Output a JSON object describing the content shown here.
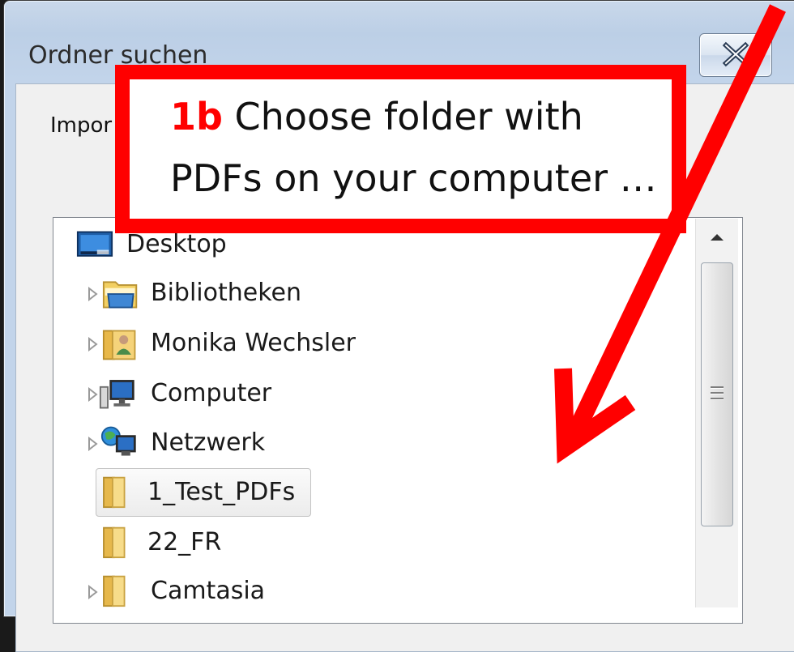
{
  "window": {
    "title": "Ordner suchen"
  },
  "prompt": "Impor",
  "tree": {
    "root": {
      "label": "Desktop",
      "icon": "desktop-icon"
    },
    "items": [
      {
        "label": "Bibliotheken",
        "icon": "libraries-icon",
        "expandable": true
      },
      {
        "label": "Monika Wechsler",
        "icon": "user-folder-icon",
        "expandable": true
      },
      {
        "label": "Computer",
        "icon": "computer-icon",
        "expandable": true
      },
      {
        "label": "Netzwerk",
        "icon": "network-icon",
        "expandable": true
      },
      {
        "label": "1_Test_PDFs",
        "icon": "folder-icon",
        "expandable": false,
        "selected": true
      },
      {
        "label": "22_FR",
        "icon": "folder-icon",
        "expandable": false
      },
      {
        "label": "Camtasia",
        "icon": "folder-icon",
        "expandable": true
      }
    ]
  },
  "callout": {
    "number": "1b",
    "line1": " Choose folder with",
    "line2": "PDFs on your computer …",
    "color": "#ff0000"
  }
}
